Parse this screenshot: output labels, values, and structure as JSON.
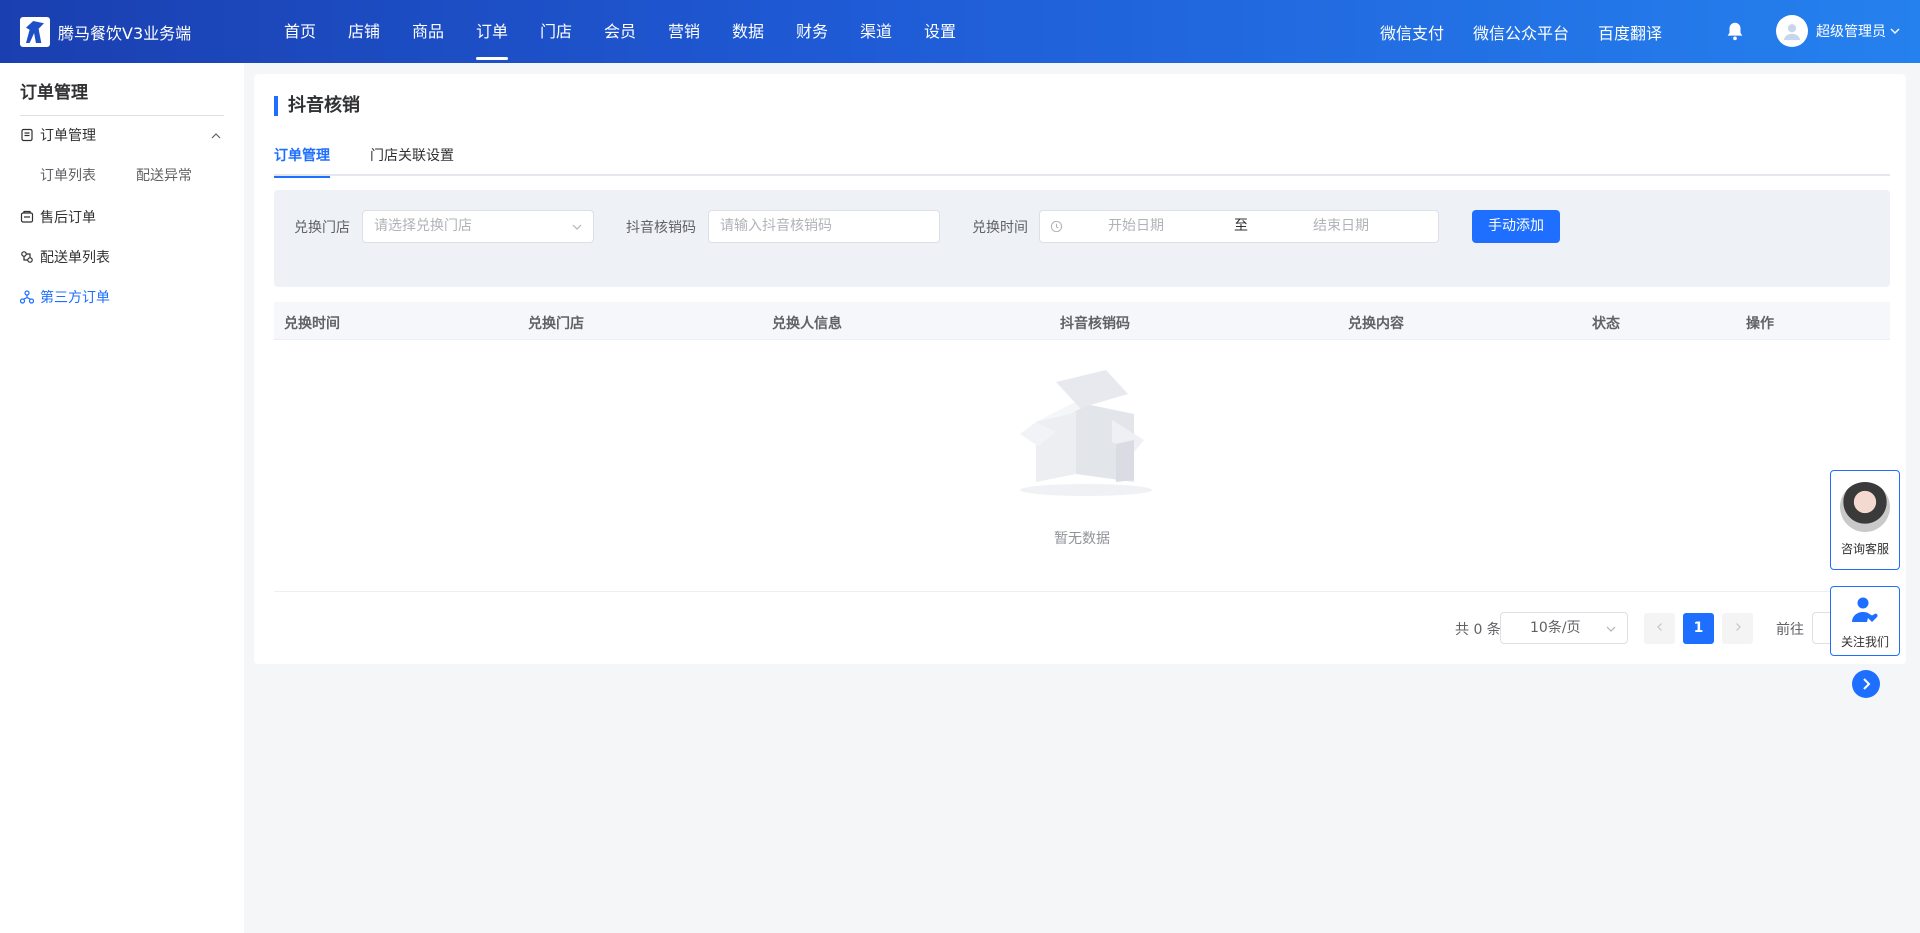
{
  "brand": {
    "name": "腾马餐饮V3业务端"
  },
  "top_nav": {
    "items": [
      "首页",
      "店铺",
      "商品",
      "订单",
      "门店",
      "会员",
      "营销",
      "数据",
      "财务",
      "渠道",
      "设置"
    ],
    "active": "订单"
  },
  "header_links": [
    "微信支付",
    "微信公众平台",
    "百度翻译"
  ],
  "user": {
    "name": "超级管理员"
  },
  "sidebar": {
    "title": "订单管理",
    "groups": [
      {
        "label": "订单管理",
        "icon": "order-doc-icon",
        "expanded": true,
        "children": [
          "订单列表",
          "配送异常"
        ]
      },
      {
        "label": "售后订单",
        "icon": "after-sales-icon"
      },
      {
        "label": "配送单列表",
        "icon": "delivery-icon"
      },
      {
        "label": "第三方订单",
        "icon": "third-party-icon",
        "active": true
      }
    ]
  },
  "page": {
    "title": "抖音核销",
    "tabs": [
      "订单管理",
      "门店关联设置"
    ],
    "active_tab": "订单管理"
  },
  "filter": {
    "store_label": "兑换门店",
    "store_placeholder": "请选择兑换门店",
    "code_label": "抖音核销码",
    "code_placeholder": "请输入抖音核销码",
    "time_label": "兑换时间",
    "start_placeholder": "开始日期",
    "range_separator": "至",
    "end_placeholder": "结束日期",
    "add_button": "手动添加"
  },
  "table": {
    "columns": [
      "兑换时间",
      "兑换门店",
      "兑换人信息",
      "抖音核销码",
      "兑换内容",
      "状态",
      "操作"
    ],
    "rows": [],
    "empty_text": "暂无数据"
  },
  "pagination": {
    "total": "共 0 条",
    "page_size": "10条/页",
    "current_page": "1",
    "goto_label": "前往"
  },
  "float_widgets": {
    "customer_service": "咨询客服",
    "follow_us": "关注我们"
  },
  "colors": {
    "primary": "#1e6fff",
    "header_gradient_start": "#1a3fb0",
    "header_gradient_end": "#2581ee"
  }
}
